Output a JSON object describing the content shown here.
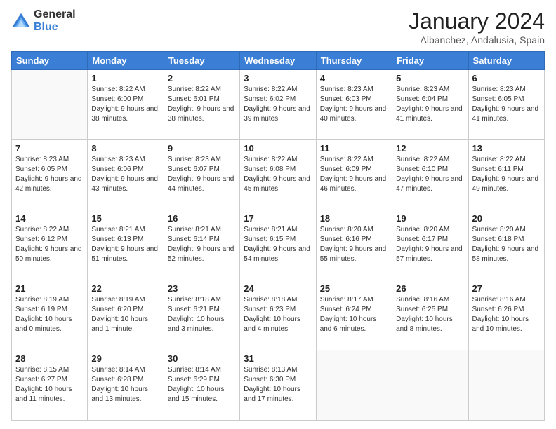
{
  "logo": {
    "general": "General",
    "blue": "Blue"
  },
  "title": "January 2024",
  "subtitle": "Albanchez, Andalusia, Spain",
  "days_header": [
    "Sunday",
    "Monday",
    "Tuesday",
    "Wednesday",
    "Thursday",
    "Friday",
    "Saturday"
  ],
  "weeks": [
    [
      {
        "day": "",
        "sunrise": "",
        "sunset": "",
        "daylight": ""
      },
      {
        "day": "1",
        "sunrise": "Sunrise: 8:22 AM",
        "sunset": "Sunset: 6:00 PM",
        "daylight": "Daylight: 9 hours and 38 minutes."
      },
      {
        "day": "2",
        "sunrise": "Sunrise: 8:22 AM",
        "sunset": "Sunset: 6:01 PM",
        "daylight": "Daylight: 9 hours and 38 minutes."
      },
      {
        "day": "3",
        "sunrise": "Sunrise: 8:22 AM",
        "sunset": "Sunset: 6:02 PM",
        "daylight": "Daylight: 9 hours and 39 minutes."
      },
      {
        "day": "4",
        "sunrise": "Sunrise: 8:23 AM",
        "sunset": "Sunset: 6:03 PM",
        "daylight": "Daylight: 9 hours and 40 minutes."
      },
      {
        "day": "5",
        "sunrise": "Sunrise: 8:23 AM",
        "sunset": "Sunset: 6:04 PM",
        "daylight": "Daylight: 9 hours and 41 minutes."
      },
      {
        "day": "6",
        "sunrise": "Sunrise: 8:23 AM",
        "sunset": "Sunset: 6:05 PM",
        "daylight": "Daylight: 9 hours and 41 minutes."
      }
    ],
    [
      {
        "day": "7",
        "sunrise": "Sunrise: 8:23 AM",
        "sunset": "Sunset: 6:05 PM",
        "daylight": "Daylight: 9 hours and 42 minutes."
      },
      {
        "day": "8",
        "sunrise": "Sunrise: 8:23 AM",
        "sunset": "Sunset: 6:06 PM",
        "daylight": "Daylight: 9 hours and 43 minutes."
      },
      {
        "day": "9",
        "sunrise": "Sunrise: 8:23 AM",
        "sunset": "Sunset: 6:07 PM",
        "daylight": "Daylight: 9 hours and 44 minutes."
      },
      {
        "day": "10",
        "sunrise": "Sunrise: 8:22 AM",
        "sunset": "Sunset: 6:08 PM",
        "daylight": "Daylight: 9 hours and 45 minutes."
      },
      {
        "day": "11",
        "sunrise": "Sunrise: 8:22 AM",
        "sunset": "Sunset: 6:09 PM",
        "daylight": "Daylight: 9 hours and 46 minutes."
      },
      {
        "day": "12",
        "sunrise": "Sunrise: 8:22 AM",
        "sunset": "Sunset: 6:10 PM",
        "daylight": "Daylight: 9 hours and 47 minutes."
      },
      {
        "day": "13",
        "sunrise": "Sunrise: 8:22 AM",
        "sunset": "Sunset: 6:11 PM",
        "daylight": "Daylight: 9 hours and 49 minutes."
      }
    ],
    [
      {
        "day": "14",
        "sunrise": "Sunrise: 8:22 AM",
        "sunset": "Sunset: 6:12 PM",
        "daylight": "Daylight: 9 hours and 50 minutes."
      },
      {
        "day": "15",
        "sunrise": "Sunrise: 8:21 AM",
        "sunset": "Sunset: 6:13 PM",
        "daylight": "Daylight: 9 hours and 51 minutes."
      },
      {
        "day": "16",
        "sunrise": "Sunrise: 8:21 AM",
        "sunset": "Sunset: 6:14 PM",
        "daylight": "Daylight: 9 hours and 52 minutes."
      },
      {
        "day": "17",
        "sunrise": "Sunrise: 8:21 AM",
        "sunset": "Sunset: 6:15 PM",
        "daylight": "Daylight: 9 hours and 54 minutes."
      },
      {
        "day": "18",
        "sunrise": "Sunrise: 8:20 AM",
        "sunset": "Sunset: 6:16 PM",
        "daylight": "Daylight: 9 hours and 55 minutes."
      },
      {
        "day": "19",
        "sunrise": "Sunrise: 8:20 AM",
        "sunset": "Sunset: 6:17 PM",
        "daylight": "Daylight: 9 hours and 57 minutes."
      },
      {
        "day": "20",
        "sunrise": "Sunrise: 8:20 AM",
        "sunset": "Sunset: 6:18 PM",
        "daylight": "Daylight: 9 hours and 58 minutes."
      }
    ],
    [
      {
        "day": "21",
        "sunrise": "Sunrise: 8:19 AM",
        "sunset": "Sunset: 6:19 PM",
        "daylight": "Daylight: 10 hours and 0 minutes."
      },
      {
        "day": "22",
        "sunrise": "Sunrise: 8:19 AM",
        "sunset": "Sunset: 6:20 PM",
        "daylight": "Daylight: 10 hours and 1 minute."
      },
      {
        "day": "23",
        "sunrise": "Sunrise: 8:18 AM",
        "sunset": "Sunset: 6:21 PM",
        "daylight": "Daylight: 10 hours and 3 minutes."
      },
      {
        "day": "24",
        "sunrise": "Sunrise: 8:18 AM",
        "sunset": "Sunset: 6:23 PM",
        "daylight": "Daylight: 10 hours and 4 minutes."
      },
      {
        "day": "25",
        "sunrise": "Sunrise: 8:17 AM",
        "sunset": "Sunset: 6:24 PM",
        "daylight": "Daylight: 10 hours and 6 minutes."
      },
      {
        "day": "26",
        "sunrise": "Sunrise: 8:16 AM",
        "sunset": "Sunset: 6:25 PM",
        "daylight": "Daylight: 10 hours and 8 minutes."
      },
      {
        "day": "27",
        "sunrise": "Sunrise: 8:16 AM",
        "sunset": "Sunset: 6:26 PM",
        "daylight": "Daylight: 10 hours and 10 minutes."
      }
    ],
    [
      {
        "day": "28",
        "sunrise": "Sunrise: 8:15 AM",
        "sunset": "Sunset: 6:27 PM",
        "daylight": "Daylight: 10 hours and 11 minutes."
      },
      {
        "day": "29",
        "sunrise": "Sunrise: 8:14 AM",
        "sunset": "Sunset: 6:28 PM",
        "daylight": "Daylight: 10 hours and 13 minutes."
      },
      {
        "day": "30",
        "sunrise": "Sunrise: 8:14 AM",
        "sunset": "Sunset: 6:29 PM",
        "daylight": "Daylight: 10 hours and 15 minutes."
      },
      {
        "day": "31",
        "sunrise": "Sunrise: 8:13 AM",
        "sunset": "Sunset: 6:30 PM",
        "daylight": "Daylight: 10 hours and 17 minutes."
      },
      {
        "day": "",
        "sunrise": "",
        "sunset": "",
        "daylight": ""
      },
      {
        "day": "",
        "sunrise": "",
        "sunset": "",
        "daylight": ""
      },
      {
        "day": "",
        "sunrise": "",
        "sunset": "",
        "daylight": ""
      }
    ]
  ]
}
